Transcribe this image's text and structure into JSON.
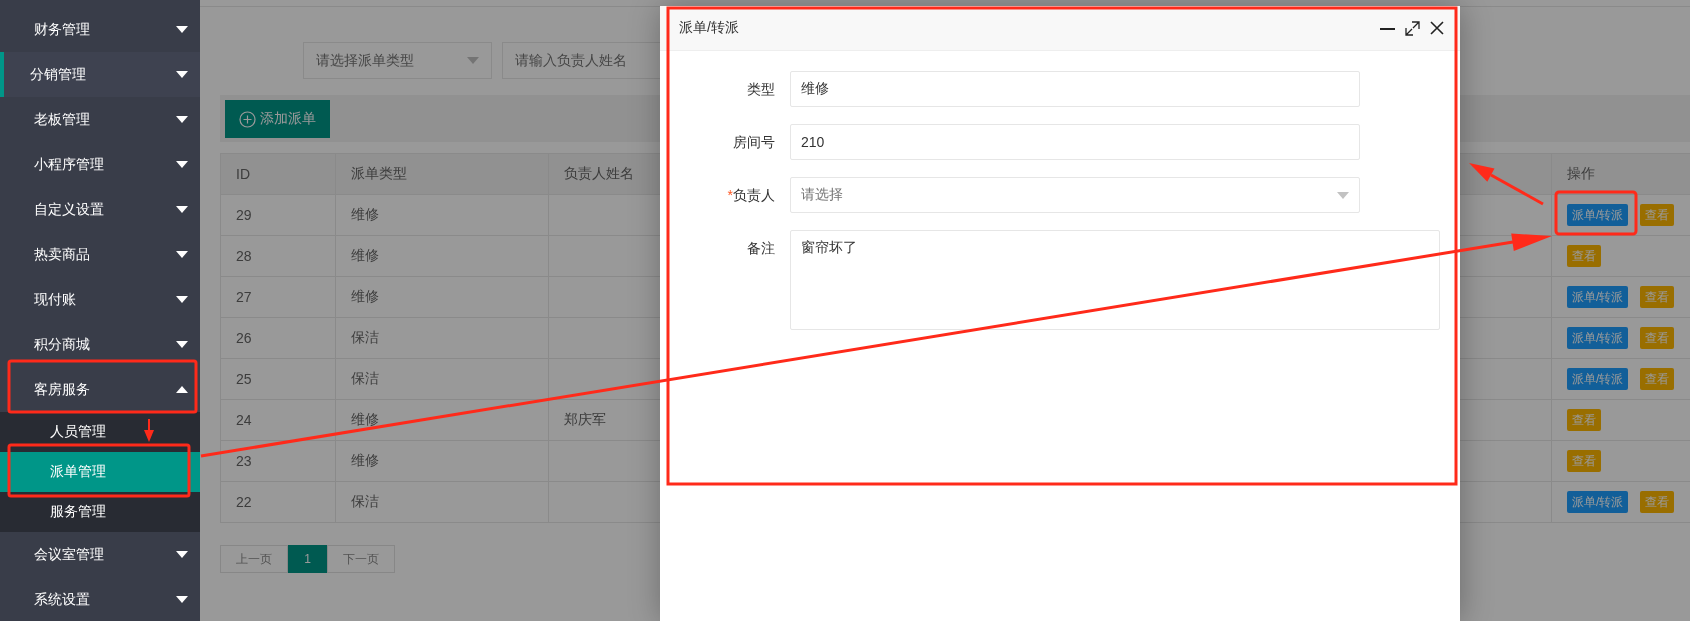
{
  "sidebar": {
    "items": [
      {
        "label": "财务管理",
        "selected": false,
        "expanded": false
      },
      {
        "label": "分销管理",
        "selected": true,
        "expanded": false
      },
      {
        "label": "老板管理",
        "selected": false,
        "expanded": false
      },
      {
        "label": "小程序管理",
        "selected": false,
        "expanded": false
      },
      {
        "label": "自定义设置",
        "selected": false,
        "expanded": false
      },
      {
        "label": "热卖商品",
        "selected": false,
        "expanded": false
      },
      {
        "label": "现付账",
        "selected": false,
        "expanded": false
      },
      {
        "label": "积分商城",
        "selected": false,
        "expanded": false
      },
      {
        "label": "客房服务",
        "selected": false,
        "expanded": true,
        "children": [
          {
            "label": "人员管理",
            "selected": false
          },
          {
            "label": "派单管理",
            "selected": true
          },
          {
            "label": "服务管理",
            "selected": false
          }
        ]
      },
      {
        "label": "会议室管理",
        "selected": false,
        "expanded": false
      },
      {
        "label": "系统设置",
        "selected": false,
        "expanded": false
      }
    ]
  },
  "filters": {
    "type_select": {
      "placeholder": "请选择派单类型"
    },
    "name_input": {
      "placeholder": "请输入负责人姓名"
    }
  },
  "toolbar": {
    "add_button": "添加派单"
  },
  "table": {
    "columns": [
      "ID",
      "派单类型",
      "负责人姓名",
      "操作"
    ],
    "rows": [
      {
        "cells": [
          "29",
          "维修"
        ],
        "actions": [
          {
            "kind": "dispatch",
            "label": "派单/转派"
          },
          {
            "kind": "view",
            "label": "查看"
          }
        ]
      },
      {
        "cells": [
          "28",
          "维修"
        ],
        "actions": [
          {
            "kind": "view",
            "label": "查看"
          }
        ]
      },
      {
        "cells": [
          "27",
          "维修"
        ],
        "actions": [
          {
            "kind": "dispatch",
            "label": "派单/转派"
          },
          {
            "kind": "view",
            "label": "查看"
          }
        ]
      },
      {
        "cells": [
          "26",
          "保洁"
        ],
        "actions": [
          {
            "kind": "dispatch",
            "label": "派单/转派"
          },
          {
            "kind": "view",
            "label": "查看"
          }
        ]
      },
      {
        "cells": [
          "25",
          "保洁"
        ],
        "actions": [
          {
            "kind": "dispatch",
            "label": "派单/转派"
          },
          {
            "kind": "view",
            "label": "查看"
          }
        ]
      },
      {
        "cells": [
          "24",
          "维修",
          "郑庆军"
        ],
        "actions": [
          {
            "kind": "view",
            "label": "查看"
          }
        ]
      },
      {
        "cells": [
          "23",
          "维修"
        ],
        "actions": [
          {
            "kind": "view",
            "label": "查看"
          }
        ]
      },
      {
        "cells": [
          "22",
          "保洁"
        ],
        "actions": [
          {
            "kind": "dispatch",
            "label": "派单/转派"
          },
          {
            "kind": "view",
            "label": "查看"
          }
        ]
      }
    ]
  },
  "pagination": {
    "prev": {
      "label": "上一页",
      "disabled": true
    },
    "pages": [
      {
        "label": "1",
        "selected": true
      }
    ],
    "next": {
      "label": "下一页",
      "disabled": true
    }
  },
  "modal": {
    "title": "派单/转派",
    "fields": [
      {
        "kind": "text",
        "label": "类型",
        "value": "维修"
      },
      {
        "kind": "text",
        "label": "房间号",
        "value": "210"
      },
      {
        "kind": "select",
        "label": "负责人",
        "mark": "*",
        "placeholder": "请选择"
      },
      {
        "kind": "textarea",
        "label": "备注",
        "value": "窗帘坏了"
      }
    ]
  }
}
